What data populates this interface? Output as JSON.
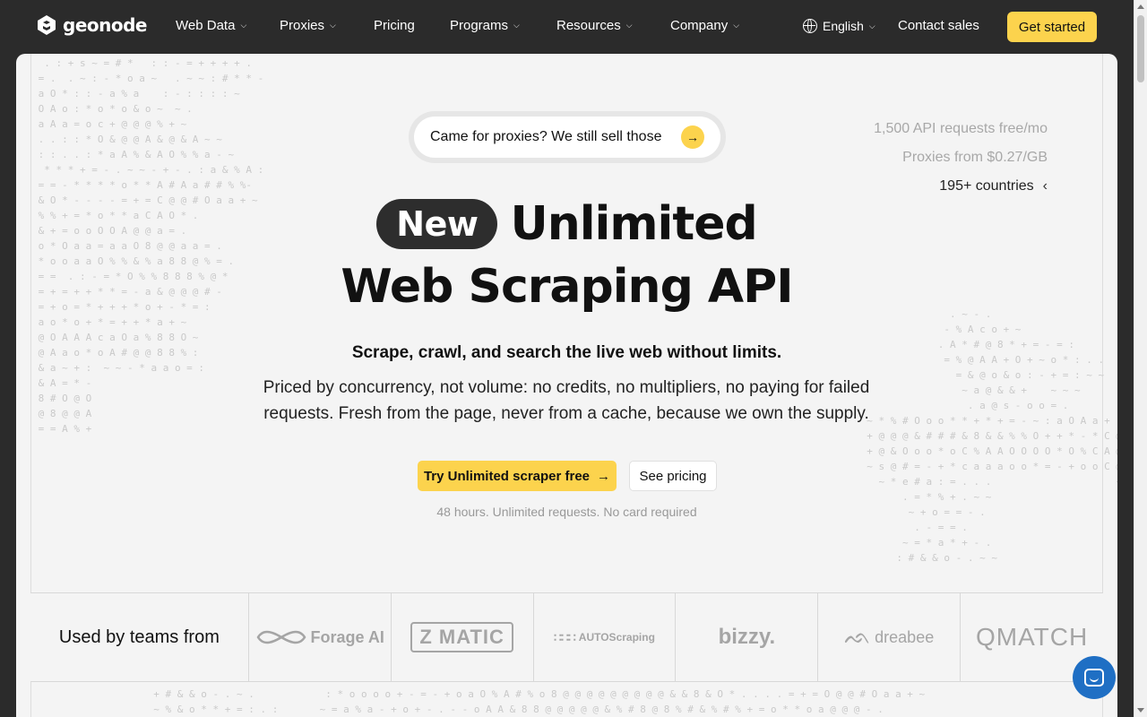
{
  "nav": {
    "logo_text": "geonode",
    "items": [
      {
        "label": "Web Data",
        "has_menu": true
      },
      {
        "label": "Proxies",
        "has_menu": true
      },
      {
        "label": "Pricing",
        "has_menu": false
      },
      {
        "label": "Programs",
        "has_menu": true
      },
      {
        "label": "Resources",
        "has_menu": true
      },
      {
        "label": "Company",
        "has_menu": true
      }
    ],
    "language": "English",
    "contact_label": "Contact sales",
    "cta_label": "Get started"
  },
  "hero": {
    "promo_text": "Came for proxies? We still sell those",
    "stats": [
      {
        "text": "1,500 API requests free/mo",
        "active": false
      },
      {
        "text": "Proxies from $0.27/GB",
        "active": false
      },
      {
        "text": "195+ countries",
        "active": true
      }
    ],
    "badge": "New",
    "title_line1": "Unlimited",
    "title_line2": "Web Scraping API",
    "subhead": "Scrape, crawl, and search the live web without limits.",
    "description": "Priced by concurrency, not volume: no credits, no multipliers, no paying for failed requests. Fresh from the page, never from a cache, because we own the supply.",
    "primary_button": "Try Unlimited scraper free",
    "secondary_button": "See pricing",
    "note": "48 hours. Unlimited requests. No card required"
  },
  "logos": {
    "label": "Used by teams from",
    "items": [
      "Forage AI",
      "MATIC",
      "AUTOScraping",
      "bizzy.",
      "dreabee",
      "QMATCH"
    ]
  },
  "colors": {
    "accent": "#fcd34d",
    "nav_bg": "#2b2b2b",
    "card_bg": "#f4f4f4",
    "chat": "#1f6fc4"
  },
  "icons": [
    "logo-mark-icon",
    "chevron-down-icon",
    "globe-icon",
    "arrow-right-icon",
    "chevron-left-icon",
    "chat-icon"
  ]
}
